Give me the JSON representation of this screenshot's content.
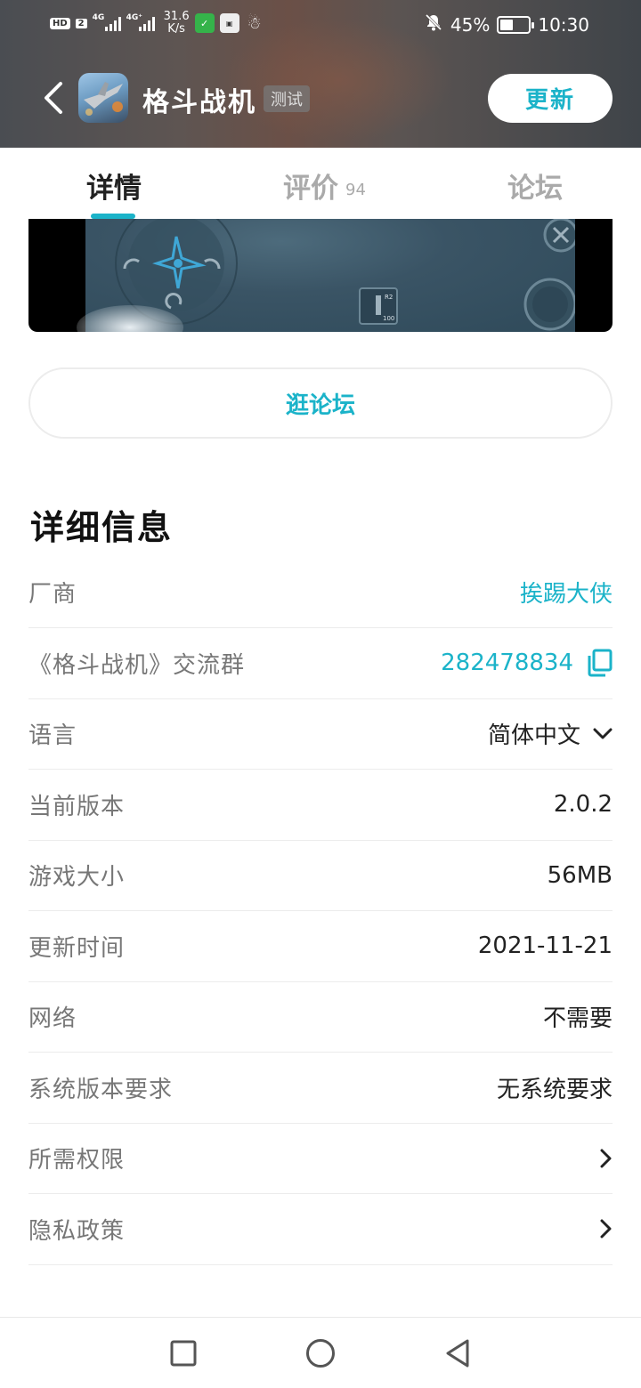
{
  "status_bar": {
    "hd": "HD",
    "sim": "2",
    "sig1": "4G",
    "sig2": "4G⁺",
    "speed_value": "31.6",
    "speed_unit": "K/s",
    "battery_percent": "45%",
    "battery_level": 0.45,
    "time": "10:30"
  },
  "header": {
    "app_name": "格斗战机",
    "tag": "测试",
    "update_label": "更新"
  },
  "tabs": [
    {
      "label": "详情",
      "active": true
    },
    {
      "label": "评价",
      "count": "94"
    },
    {
      "label": "论坛"
    }
  ],
  "banner": {
    "r2": "R2",
    "ammo": "100"
  },
  "forum_button": "逛论坛",
  "details": {
    "title": "详细信息",
    "rows": [
      {
        "label": "厂商",
        "value": "挨踢大侠"
      },
      {
        "label": "《格斗战机》交流群",
        "value": "282478834"
      },
      {
        "label": "语言",
        "value": "简体中文"
      },
      {
        "label": "当前版本",
        "value": "2.0.2"
      },
      {
        "label": "游戏大小",
        "value": "56MB"
      },
      {
        "label": "更新时间",
        "value": "2021-11-21"
      },
      {
        "label": "网络",
        "value": "不需要"
      },
      {
        "label": "系统版本要求",
        "value": "无系统要求"
      },
      {
        "label": "所需权限",
        "value": ""
      },
      {
        "label": "隐私政策",
        "value": ""
      }
    ]
  },
  "colors": {
    "accent": "#1bb3c9",
    "label": "#777777",
    "divider": "#ececec"
  },
  "icons": {
    "back": "chevron-left-icon",
    "copy": "copy-icon",
    "dropdown": "chevron-down-icon",
    "arrow": "chevron-right-icon",
    "nav_recent": "square-icon",
    "nav_home": "circle-icon",
    "nav_back": "triangle-back-icon"
  }
}
